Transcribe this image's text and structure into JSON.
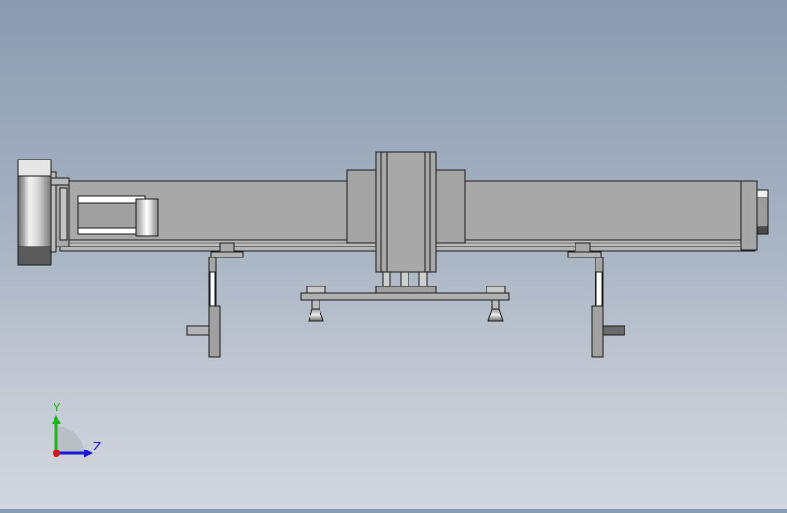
{
  "viewport": {
    "background_top": "#8b9bb0",
    "background_bottom": "#d2d6de"
  },
  "model": {
    "body_color": "#a8a8a8",
    "edge_color": "#1a1a1a",
    "highlight_color": "#f4f4f4",
    "dark_color": "#505050"
  },
  "triad": {
    "y_label": "Y",
    "z_label": "Z",
    "y_color": "#1db41d",
    "z_color": "#1a1ad6",
    "x_color": "#d01818"
  }
}
